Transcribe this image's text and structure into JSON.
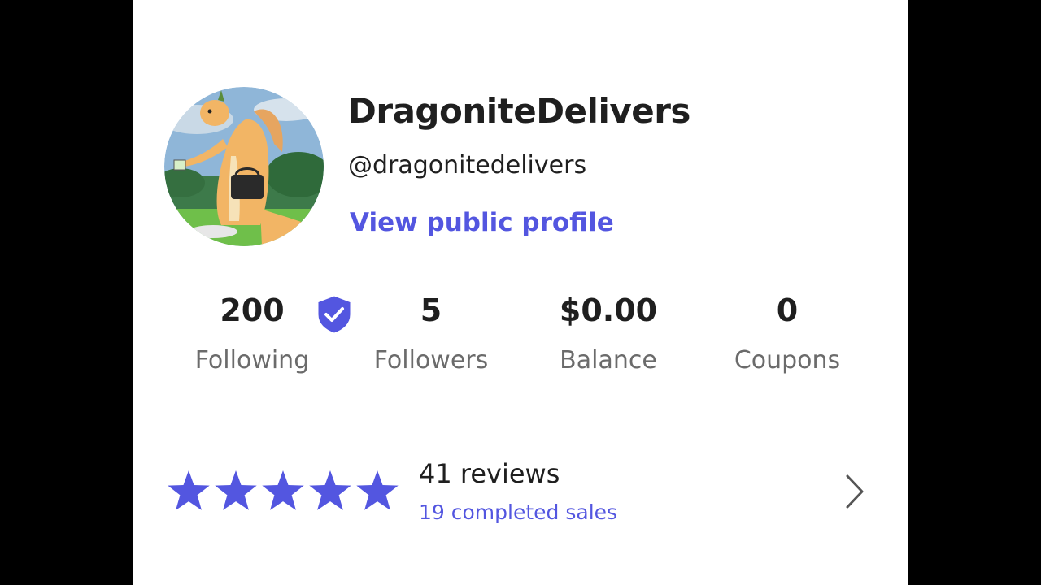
{
  "profile": {
    "display_name": "DragoniteDelivers",
    "handle": "@dragonitedelivers",
    "view_public_profile_label": "View public profile",
    "verified": true
  },
  "stats": [
    {
      "value": "200",
      "label": "Following"
    },
    {
      "value": "5",
      "label": "Followers"
    },
    {
      "value": "$0.00",
      "label": "Balance"
    },
    {
      "value": "0",
      "label": "Coupons"
    }
  ],
  "rating": {
    "stars": 5,
    "reviews_label": "41 reviews",
    "sales_label": "19 completed sales"
  },
  "icons": {
    "verified": "shield-check-icon",
    "star": "star-icon",
    "chevron": "chevron-right-icon"
  },
  "colors": {
    "accent": "#5356e0",
    "text_primary": "#1f1f1f",
    "text_secondary": "#6b6b6b",
    "background": "#ffffff",
    "letterbox": "#000000"
  }
}
